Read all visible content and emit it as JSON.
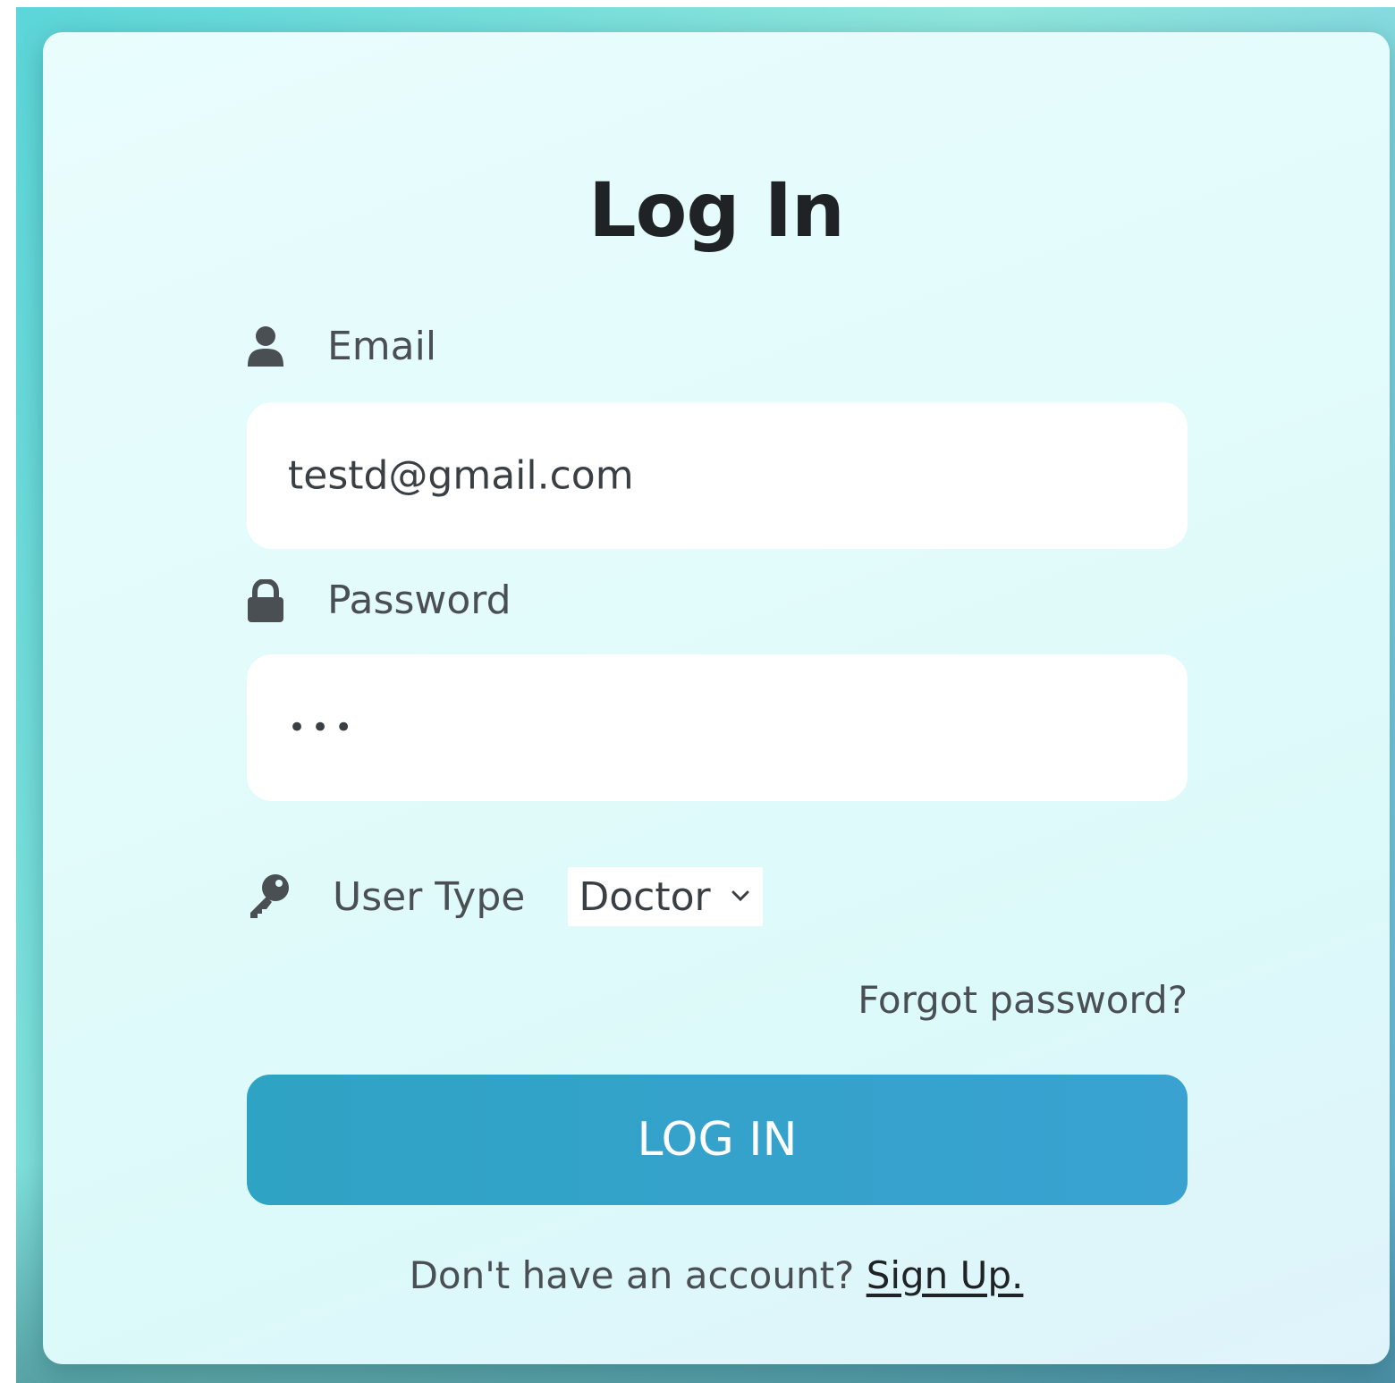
{
  "form": {
    "title": "Log In",
    "email_label": "Email",
    "email_value": "testd@gmail.com",
    "password_label": "Password",
    "password_mask": "•••",
    "user_type_label": "User Type",
    "user_type_selected": "Doctor",
    "forgot_password": "Forgot password?",
    "login_button": "LOG IN",
    "signup_prompt": "Don't have an account?",
    "signup_link": "Sign Up."
  },
  "icons": {
    "email": "user-icon",
    "password": "lock-icon",
    "user_type": "key-icon",
    "select": "chevron-down-icon"
  },
  "colors": {
    "button": "#33a3c9",
    "card": "#e3fbfb",
    "backdrop": "#7fd9db",
    "title": "#1f2326"
  }
}
